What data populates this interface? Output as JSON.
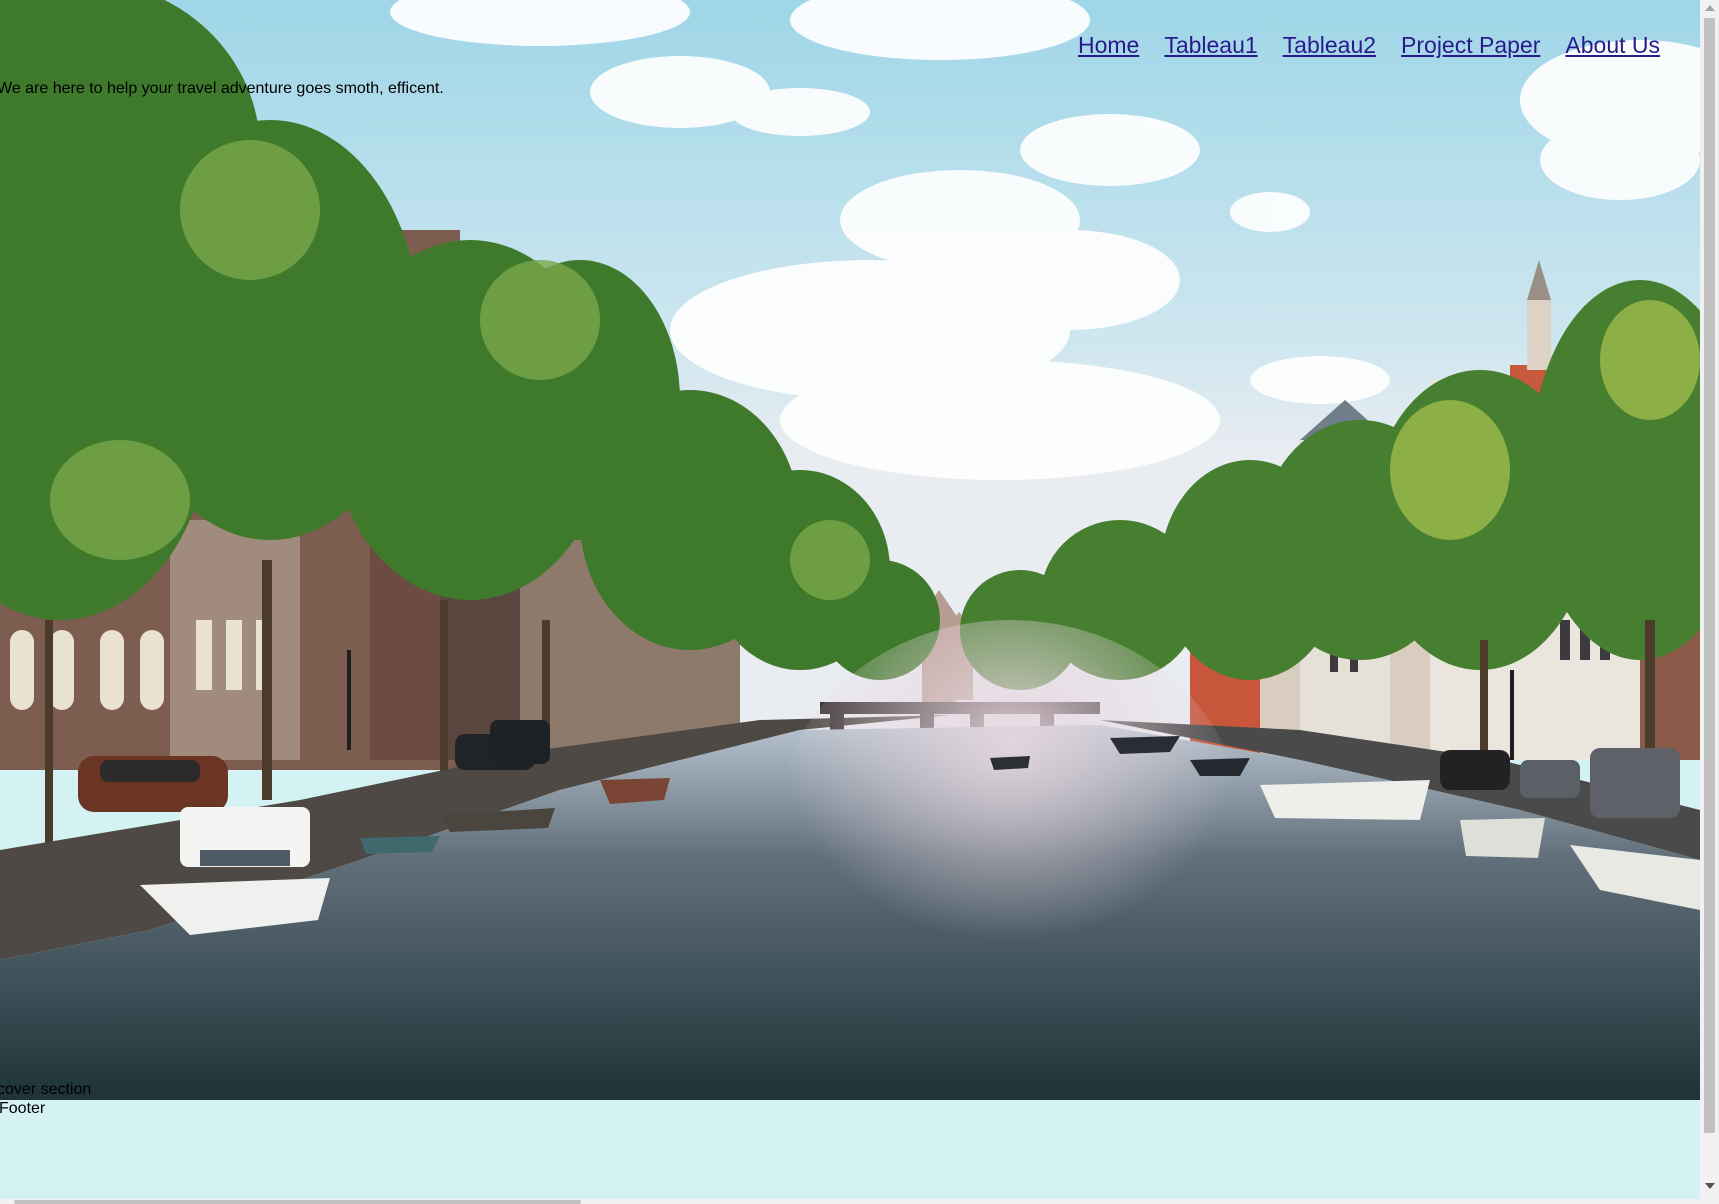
{
  "nav": {
    "items": [
      {
        "label": "Home"
      },
      {
        "label": "Tableau1"
      },
      {
        "label": "Tableau2"
      },
      {
        "label": "Project Paper"
      },
      {
        "label": "About Us"
      }
    ]
  },
  "hero": {
    "tagline": "We are here to help your travel adventure goes smoth, efficent.",
    "cover_label": "cover section",
    "image_description": "canal-cityscape-photo"
  },
  "footer": {
    "label": "Footer"
  },
  "colors": {
    "link": "#2a1a8c",
    "footer_bg": "#d4f1f4"
  }
}
